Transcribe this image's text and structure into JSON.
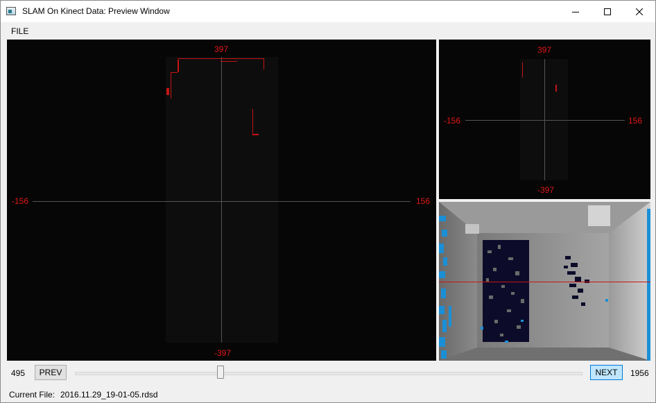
{
  "window": {
    "title": "SLAM On Kinect Data: Preview Window",
    "icons": {
      "app": "app-window-icon",
      "minimize": "minimize-icon",
      "maximize": "maximize-icon",
      "close": "close-icon"
    }
  },
  "menu": {
    "items": [
      "FILE"
    ]
  },
  "main_view": {
    "top_label": "397",
    "bottom_label": "-397",
    "left_label": "-156",
    "right_label": "156",
    "label_color": "#e21717"
  },
  "top_view": {
    "top_label": "397",
    "bottom_label": "-397",
    "left_label": "-156",
    "right_label": "156"
  },
  "depth_view": {
    "highlight_color": "#1a8fd6",
    "scanline_color": "#cc1010"
  },
  "slider": {
    "current": "495",
    "total": "1956",
    "value": 495,
    "max": 1956,
    "prev_label": "PREV",
    "next_label": "NEXT"
  },
  "status": {
    "label": "Current File:",
    "value": "2016.11.29_19-01-05.rdsd"
  }
}
